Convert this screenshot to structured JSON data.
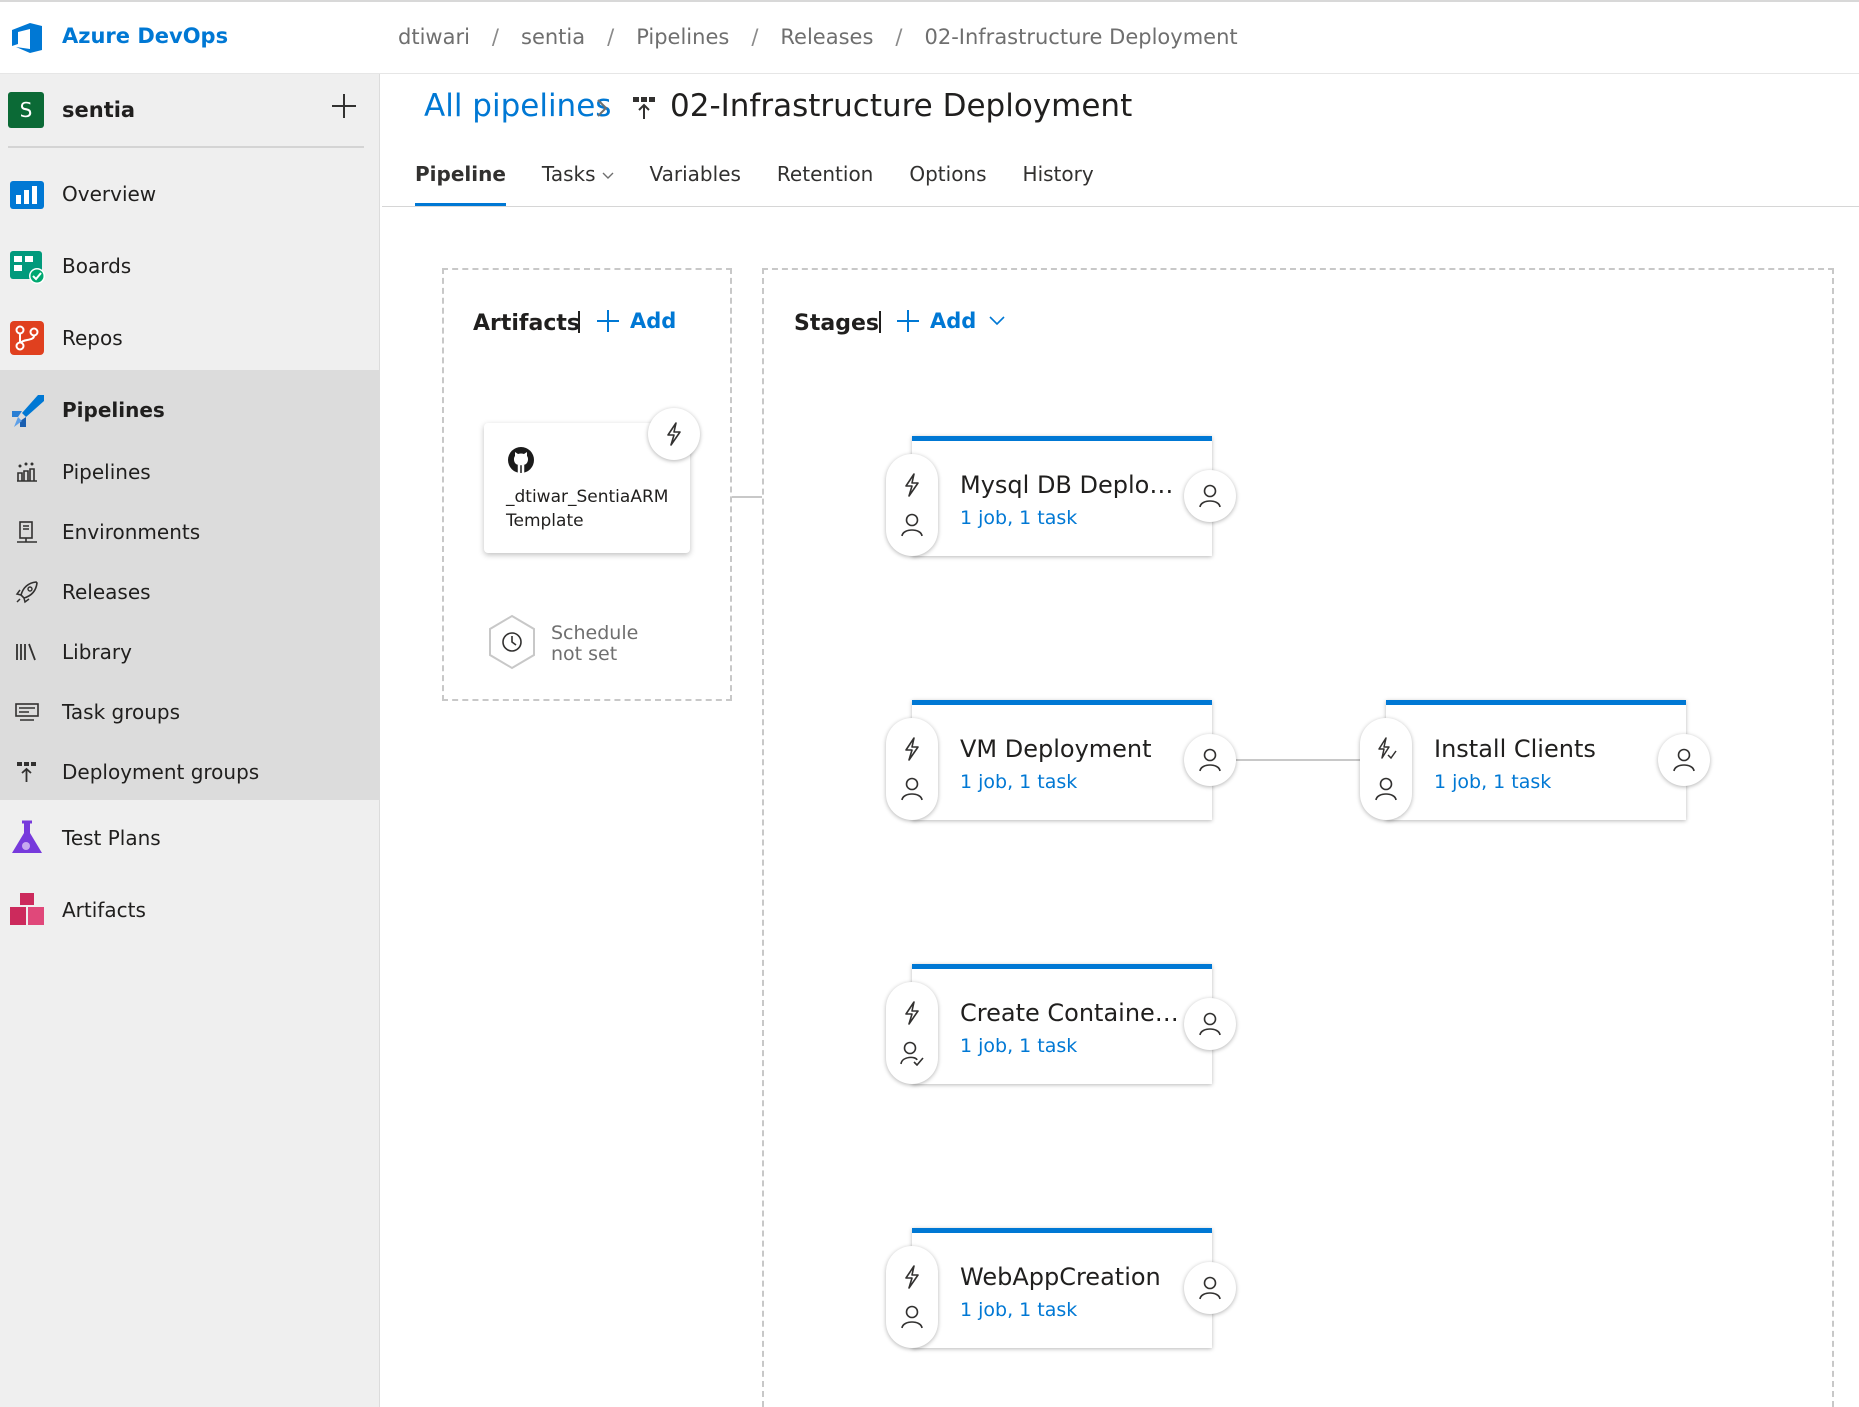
{
  "app": {
    "brand": "Azure DevOps"
  },
  "breadcrumb": [
    "dtiwari",
    "sentia",
    "Pipelines",
    "Releases",
    "02-Infrastructure Deployment"
  ],
  "breadcrumb_separator": "/",
  "sidebar": {
    "project_initial": "S",
    "project_name": "sentia",
    "items": [
      {
        "label": "Overview",
        "icon": "overview-icon"
      },
      {
        "label": "Boards",
        "icon": "boards-icon"
      },
      {
        "label": "Repos",
        "icon": "repos-icon"
      },
      {
        "label": "Pipelines",
        "icon": "pipelines-icon"
      },
      {
        "label": "Pipelines",
        "icon": "pipelines-sub-icon"
      },
      {
        "label": "Environments",
        "icon": "environments-icon"
      },
      {
        "label": "Releases",
        "icon": "releases-icon"
      },
      {
        "label": "Library",
        "icon": "library-icon"
      },
      {
        "label": "Task groups",
        "icon": "task-groups-icon"
      },
      {
        "label": "Deployment groups",
        "icon": "deployment-groups-icon"
      },
      {
        "label": "Test Plans",
        "icon": "test-plans-icon"
      },
      {
        "label": "Artifacts",
        "icon": "artifacts-icon"
      }
    ]
  },
  "header": {
    "all_pipelines": "All pipelines",
    "title": "02-Infrastructure Deployment"
  },
  "tabs": [
    "Pipeline",
    "Tasks",
    "Variables",
    "Retention",
    "Options",
    "History"
  ],
  "artifacts": {
    "title": "Artifacts",
    "add_label": "Add",
    "artifact_name": "_dtiwar_SentiaARMTemplate",
    "schedule_text": "Schedule not set"
  },
  "stages": {
    "title": "Stages",
    "add_label": "Add",
    "items": [
      {
        "name": "Mysql DB Deploy...",
        "summary": "1 job, 1 task"
      },
      {
        "name": "VM Deployment",
        "summary": "1 job, 1 task"
      },
      {
        "name": "Install Clients",
        "summary": "1 job, 1 task"
      },
      {
        "name": "Create Container R...",
        "summary": "1 job, 1 task"
      },
      {
        "name": "WebAppCreation",
        "summary": "1 job, 1 task"
      }
    ]
  },
  "colors": {
    "accent": "#0078d4",
    "project_avatar": "#0b6a36",
    "sidebar_bg": "#efefef"
  }
}
